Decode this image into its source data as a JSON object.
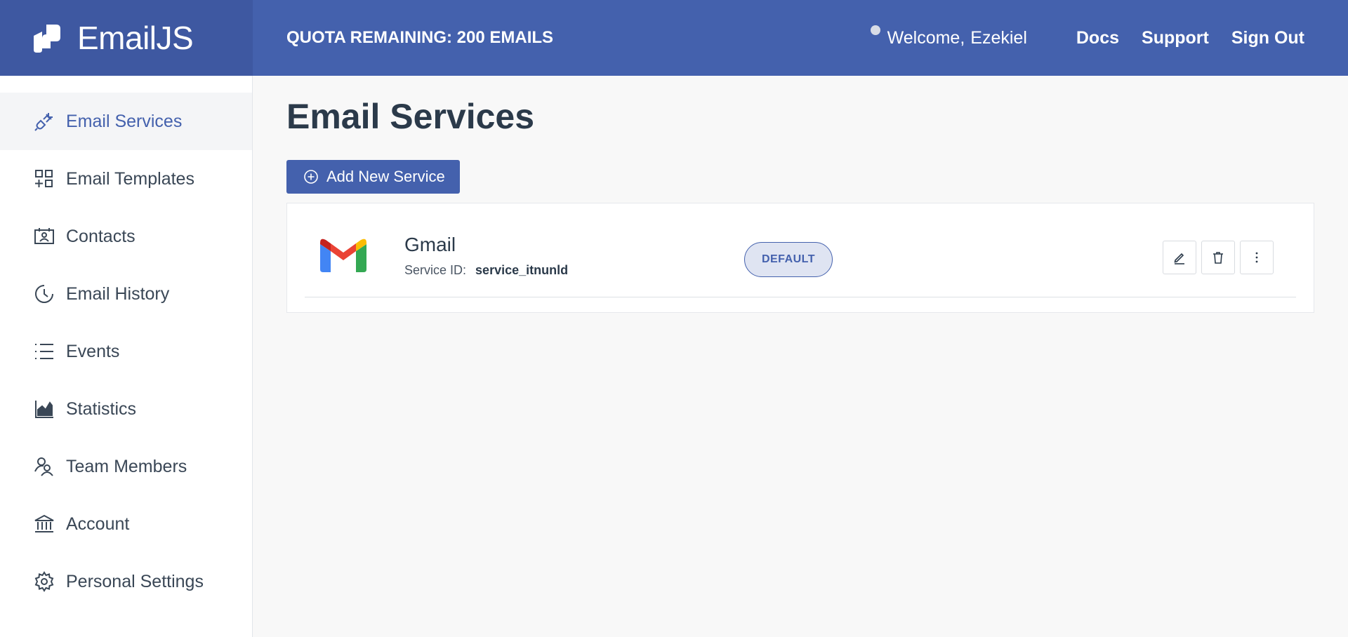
{
  "header": {
    "brand_name": "EmailJS",
    "quota": "QUOTA REMAINING: 200 EMAILS",
    "welcome_prefix": "Welcome,",
    "user_name": "Ezekiel",
    "links": {
      "docs": "Docs",
      "support": "Support",
      "sign_out": "Sign Out"
    }
  },
  "sidebar": {
    "items": [
      {
        "label": "Email Services",
        "icon": "plug-icon",
        "active": true
      },
      {
        "label": "Email Templates",
        "icon": "templates-icon"
      },
      {
        "label": "Contacts",
        "icon": "contacts-icon"
      },
      {
        "label": "Email History",
        "icon": "history-icon"
      },
      {
        "label": "Events",
        "icon": "list-icon"
      },
      {
        "label": "Statistics",
        "icon": "chart-icon"
      },
      {
        "label": "Team Members",
        "icon": "team-icon"
      },
      {
        "label": "Account",
        "icon": "bank-icon"
      },
      {
        "label": "Personal Settings",
        "icon": "gear-icon"
      }
    ]
  },
  "main": {
    "title": "Email Services",
    "add_button": "Add New Service",
    "services": [
      {
        "name": "Gmail",
        "service_id_label": "Service ID:",
        "service_id": "service_itnunld",
        "badge": "DEFAULT",
        "icon": "gmail-logo"
      }
    ]
  },
  "colors": {
    "brand": "#4461ad",
    "brand_dark": "#3e58a1",
    "text": "#2b3a4a"
  }
}
